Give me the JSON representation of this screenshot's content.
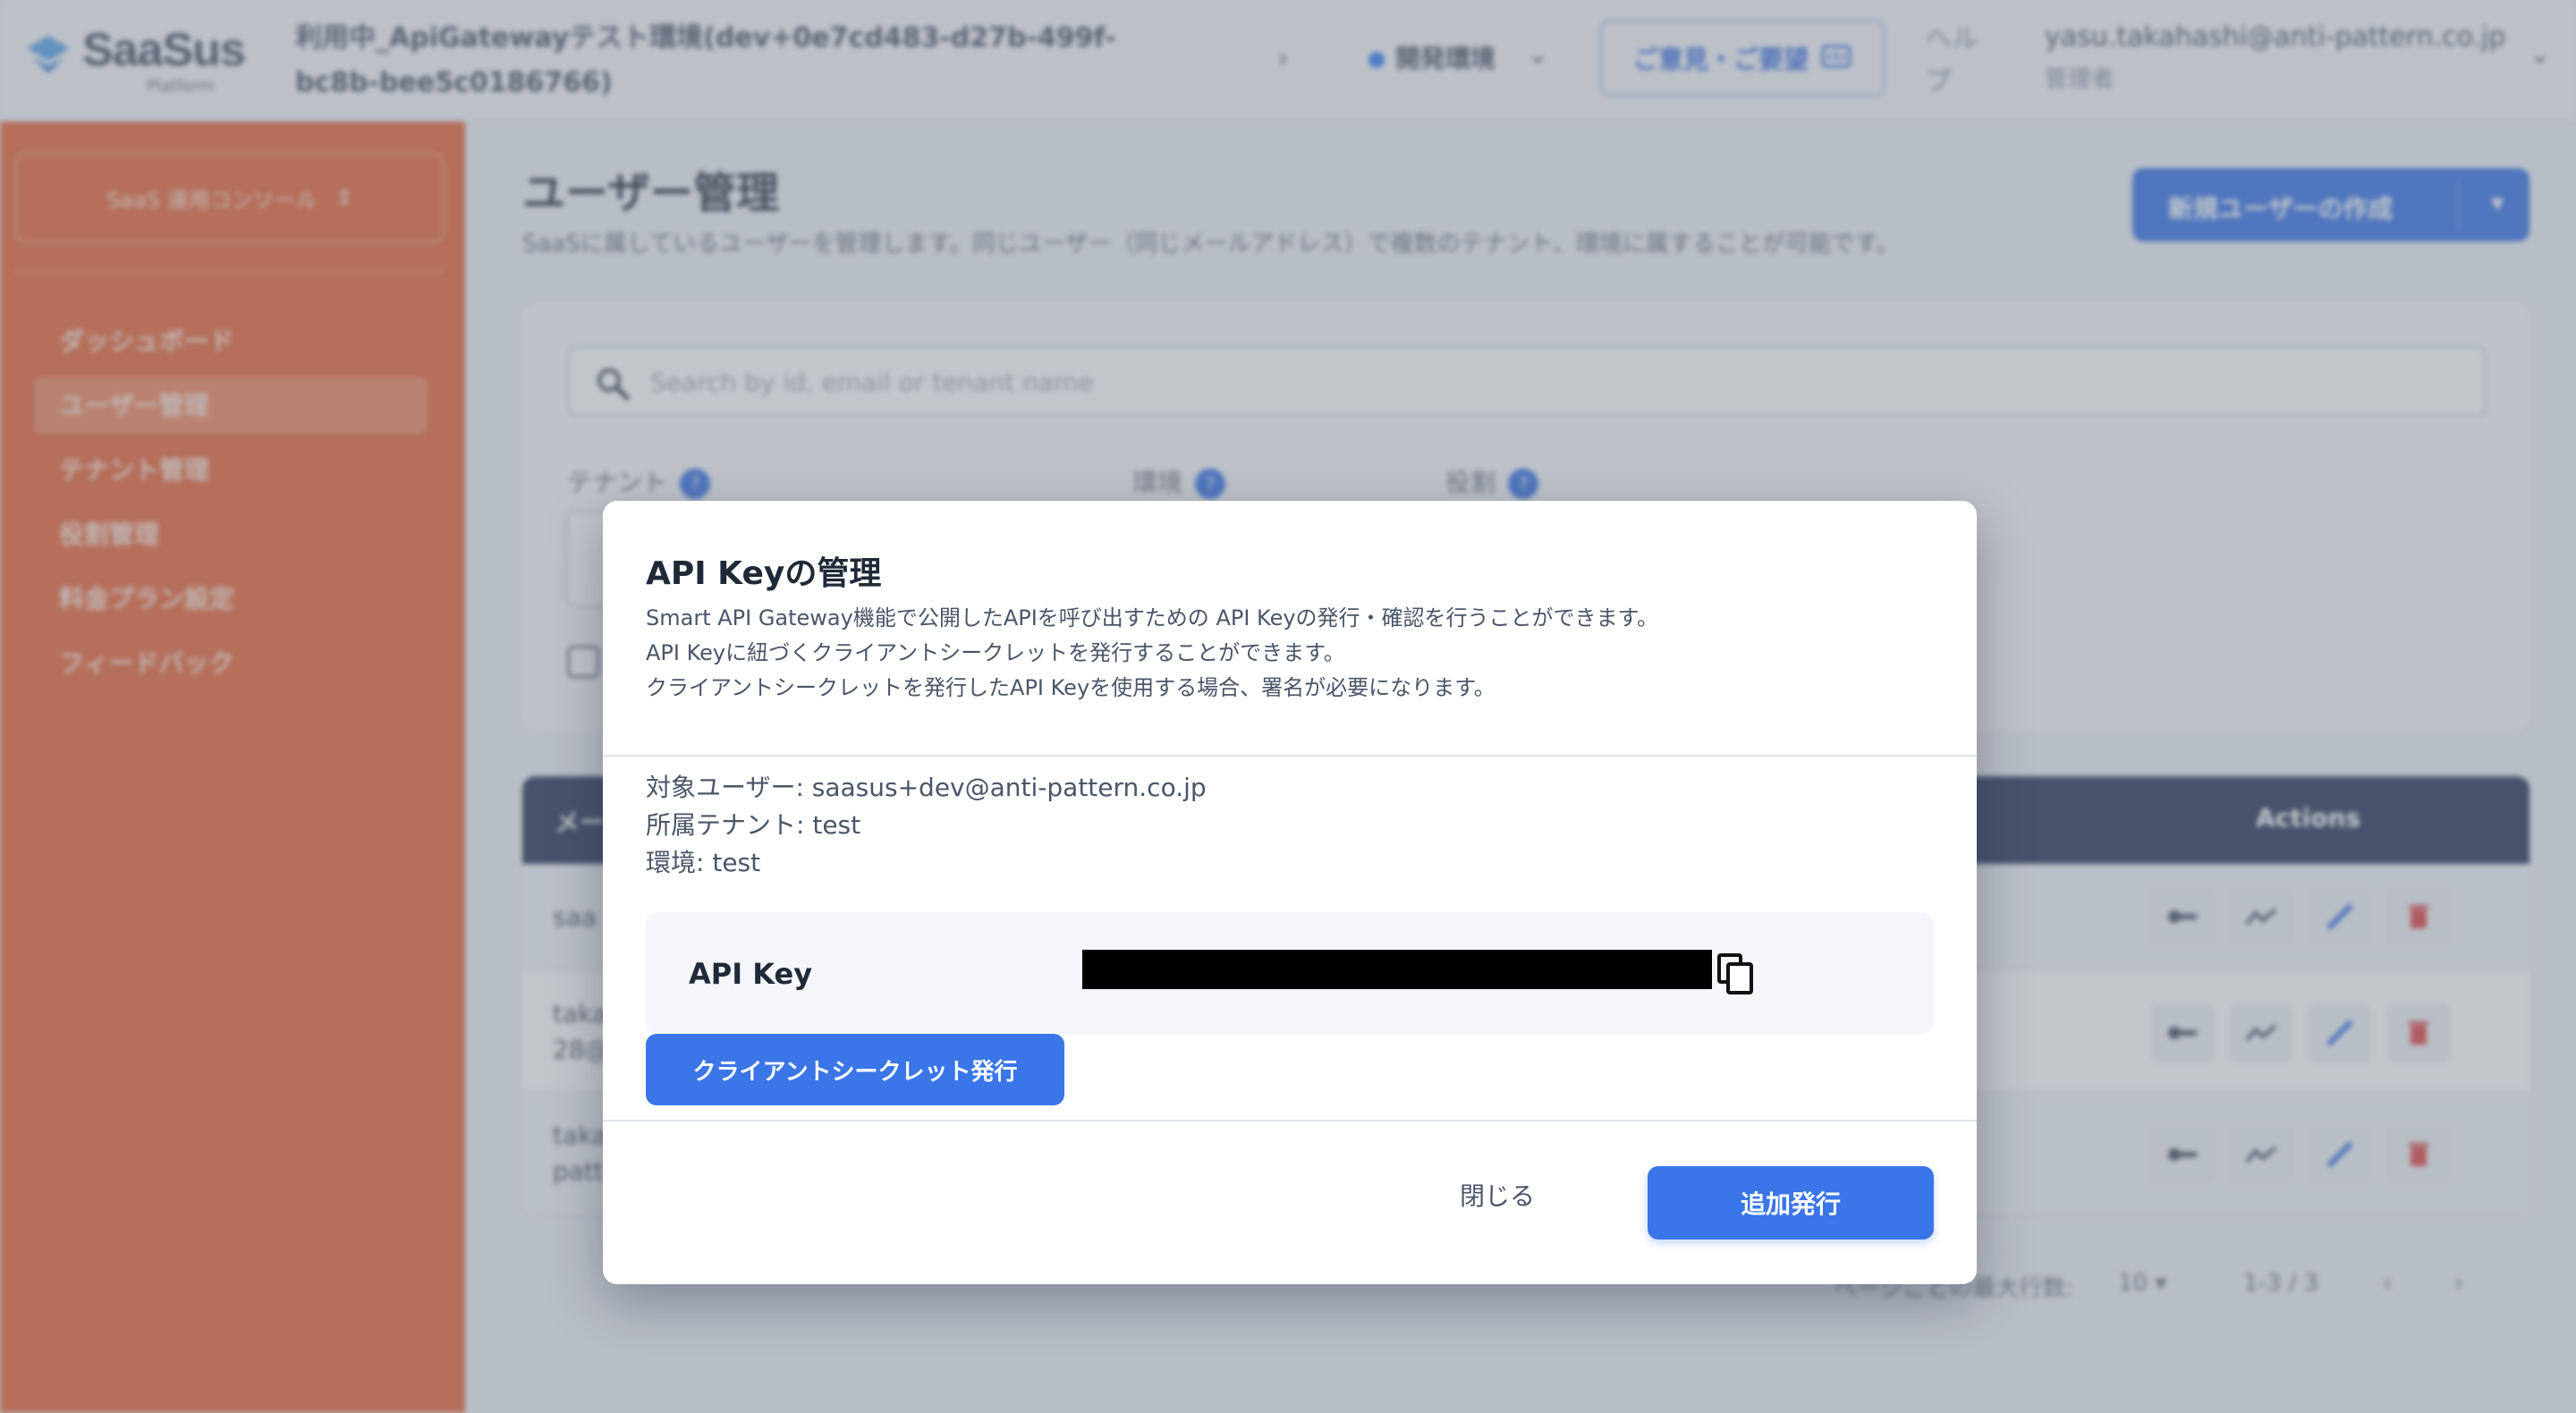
{
  "topbar": {
    "logo_text": "SaaSus",
    "logo_sub": "Platform",
    "env_title": "利用中_ApiGatewayテスト環境(dev+0e7cd483-d27b-499f-bc8b-bee5c0186766)",
    "env_name": "開発環境",
    "feedback_label": "ご意見・ご要望",
    "help_label": "ヘルプ",
    "user_email": "yasu.takahashi@anti-pattern.co.jp",
    "user_role": "管理者"
  },
  "sidebar": {
    "console_label": "SaaS 運用コンソール",
    "items": [
      {
        "label": "ダッシュボード",
        "active": false
      },
      {
        "label": "ユーザー管理",
        "active": true
      },
      {
        "label": "テナント管理",
        "active": false
      },
      {
        "label": "役割管理",
        "active": false
      },
      {
        "label": "料金プラン設定",
        "active": false
      },
      {
        "label": "フィードバック",
        "active": false
      }
    ]
  },
  "main": {
    "title": "ユーザー管理",
    "description": "SaaSに属しているユーザーを管理します。同じユーザー（同じメールアドレス）で複数のテナント、環境に属することが可能です。",
    "create_button": "新規ユーザーの作成",
    "search_placeholder": "Search by id, email or tenant name",
    "filters": {
      "tenant": "テナント",
      "env": "環境",
      "role": "役割"
    },
    "table": {
      "header_mail": "メー",
      "header_actions": "Actions",
      "rows": [
        {
          "text": "saa"
        },
        {
          "text": "taka\n28@"
        },
        {
          "text": "taka\npatt"
        }
      ]
    },
    "pager": {
      "rows_label": "ページごとの最大行数:",
      "rows_value": "10",
      "range": "1-3 / 3"
    }
  },
  "modal": {
    "title": "API Keyの管理",
    "description": [
      "Smart API Gateway機能で公開したAPIを呼び出すための API Keyの発行・確認を行うことができます。",
      "API Keyに紐づくクライアントシークレットを発行することができます。",
      "クライアントシークレットを発行したAPI Keyを使用する場合、署名が必要になります。"
    ],
    "target_user": "対象ユーザー: saasus+dev@anti-pattern.co.jp",
    "tenant": "所属テナント: test",
    "environment": "環境: test",
    "api_key_label": "API Key",
    "issue_secret_button": "クライアントシークレット発行",
    "close_button": "閉じる",
    "add_issue_button": "追加発行"
  },
  "colors": {
    "sidebar": "#e8693e",
    "primary": "#3a76e8",
    "table_header": "#2c3a5c",
    "delete_icon": "#e04a4a"
  }
}
